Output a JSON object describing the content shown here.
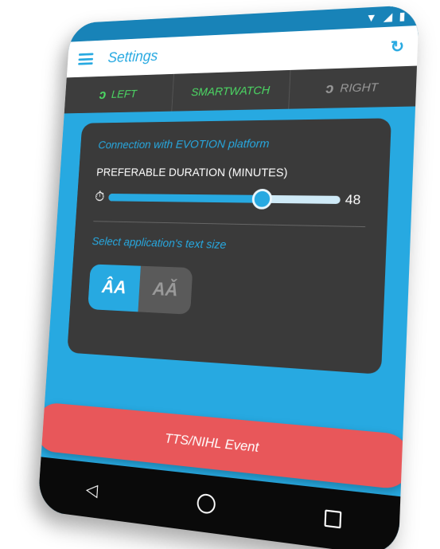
{
  "app_bar": {
    "title": "Settings",
    "menu_icon": "hamburger-menu-icon",
    "refresh_icon": "refresh-icon"
  },
  "status_bar": {
    "icons": [
      "wifi-icon",
      "signal-icon",
      "battery-icon"
    ]
  },
  "tabs": [
    {
      "label": "LEFT",
      "icon": "left-ear-icon",
      "active": true,
      "color": "#4cd964"
    },
    {
      "label": "SMARTWATCH",
      "active": true,
      "color": "#4cd964"
    },
    {
      "label": "RIGHT",
      "icon": "right-ear-icon",
      "active": false,
      "color": "#9a9a9a"
    }
  ],
  "settings": {
    "connection_label": "Connection with EVOTION platform",
    "duration_label": "PREFERABLE DURATION (MINUTES)",
    "duration_value": "48",
    "duration_fraction": 0.68,
    "text_size_label": "Select application's text size",
    "text_size_options": [
      {
        "label": "ÂA",
        "selected": true
      },
      {
        "label": "AǍ",
        "selected": false
      }
    ]
  },
  "event_button": {
    "label": "TTS/NIHL Event"
  },
  "nav": {
    "back": "◁",
    "home": "home-icon",
    "recents": "recents-icon"
  },
  "colors": {
    "accent": "#27a9e1",
    "active_tab": "#4cd964",
    "event_button": "#e8575a",
    "card": "#3a3a3a"
  }
}
